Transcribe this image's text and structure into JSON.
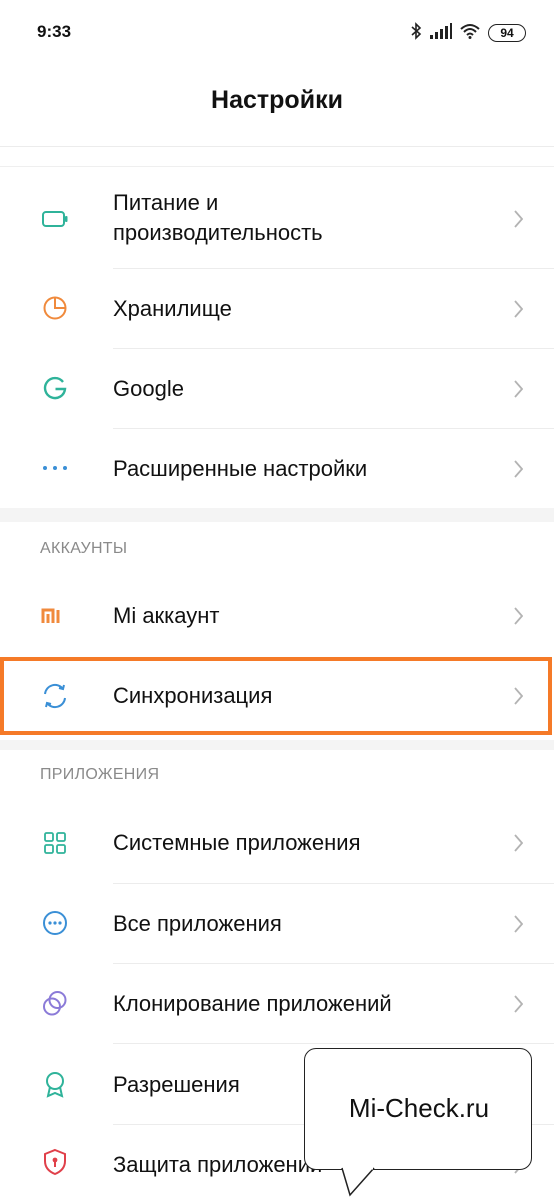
{
  "status": {
    "time": "9:33",
    "battery": "94"
  },
  "header": {
    "title": "Настройки"
  },
  "rows_top": [
    {
      "label_line1": "Питание и",
      "label_line2": "производительность",
      "icon": "battery-icon"
    },
    {
      "label": "Хранилище",
      "icon": "pie-chart-icon"
    },
    {
      "label": "Google",
      "icon": "google-icon"
    },
    {
      "label": "Расширенные настройки",
      "icon": "more-dots-icon"
    }
  ],
  "accounts": {
    "header": "АККАУНТЫ",
    "items": [
      {
        "label": "Mi аккаунт",
        "icon": "mi-logo-icon"
      },
      {
        "label": "Синхронизация",
        "icon": "sync-icon"
      }
    ]
  },
  "apps": {
    "header": "ПРИЛОЖЕНИЯ",
    "items": [
      {
        "label": "Системные приложения",
        "icon": "grid-icon"
      },
      {
        "label": "Все приложения",
        "icon": "chat-dots-icon"
      },
      {
        "label": "Клонирование приложений",
        "icon": "clone-circles-icon"
      },
      {
        "label": "Разрешения",
        "icon": "ribbon-icon"
      },
      {
        "label": "Защита приложений",
        "icon": "shield-lock-icon"
      }
    ]
  },
  "watermark": {
    "text": "Mi-Check.ru"
  },
  "colors": {
    "highlight": "#f57a28",
    "teal": "#2fb39a",
    "orange": "#f08a3c",
    "blue": "#3a8fd6",
    "purple": "#8b7bd8",
    "red": "#e0404a"
  }
}
